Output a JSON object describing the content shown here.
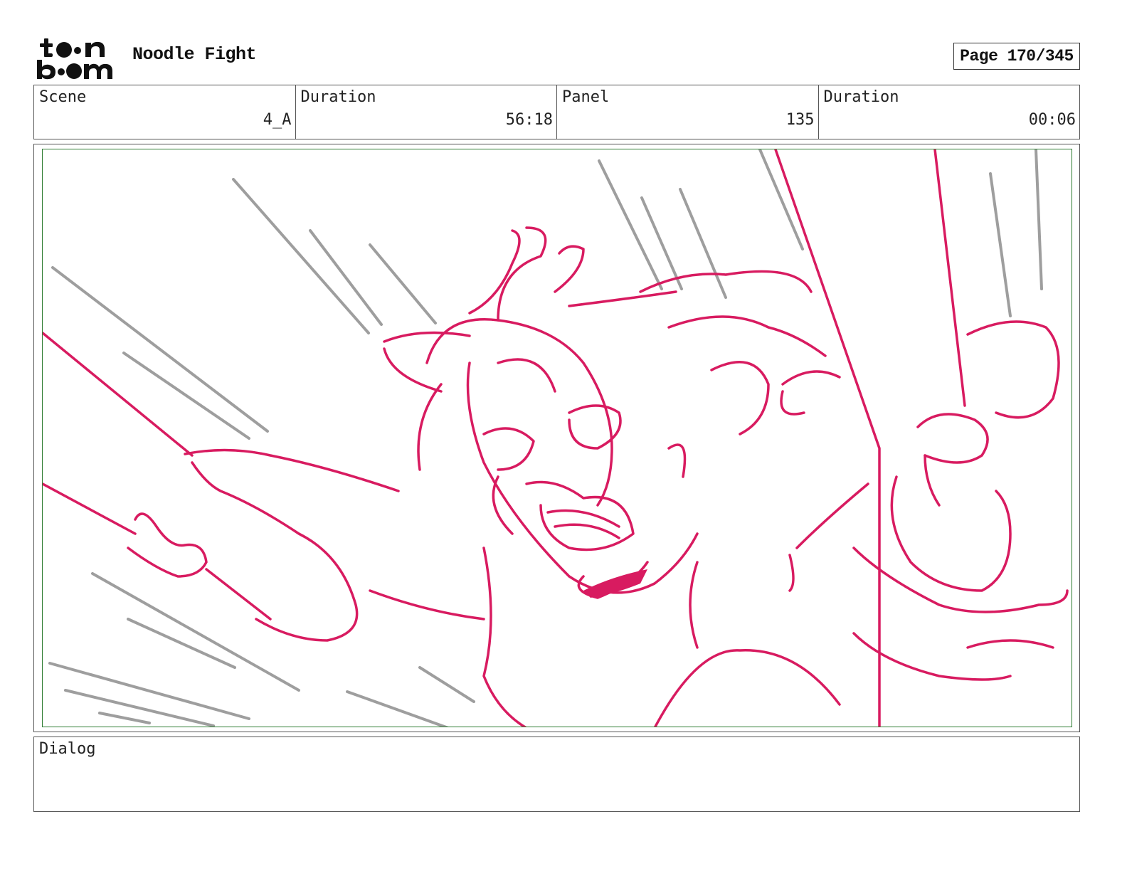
{
  "header": {
    "logo_name": "toon boom",
    "project_title": "Noodle Fight",
    "page_label": "Page 170/345"
  },
  "info": {
    "scene": {
      "label": "Scene",
      "value": "4_A"
    },
    "scene_duration": {
      "label": "Duration",
      "value": "56:18"
    },
    "panel": {
      "label": "Panel",
      "value": "135"
    },
    "panel_duration": {
      "label": "Duration",
      "value": "00:06"
    }
  },
  "panel_image": {
    "description_icon": "storyboard-sketch",
    "sketch_color": "#d81b60",
    "speedline_color": "#9e9e9e",
    "safe_area_color": "#2e7d32"
  },
  "dialog": {
    "label": "Dialog",
    "text": ""
  }
}
